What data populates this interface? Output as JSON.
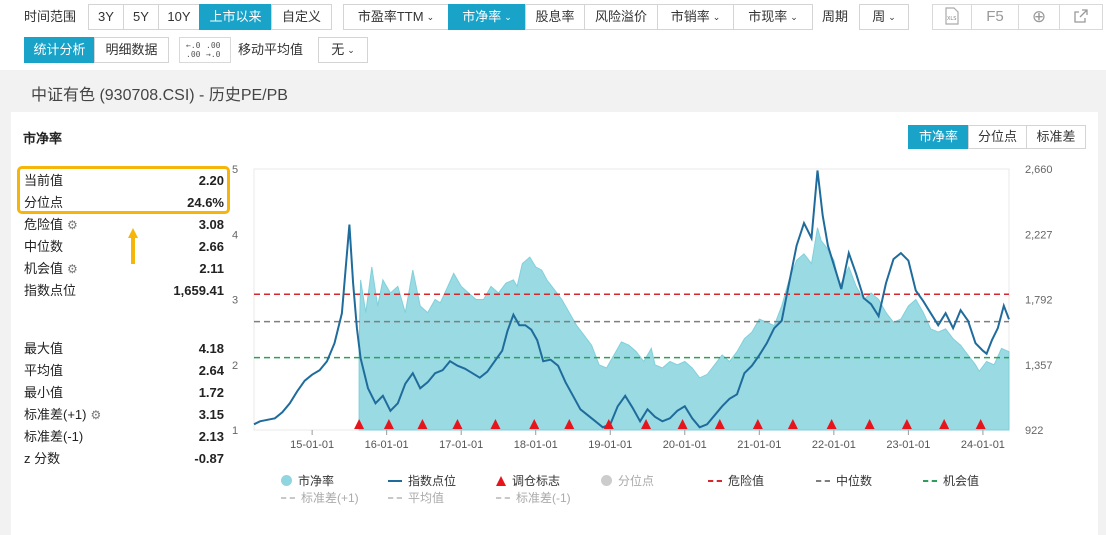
{
  "toolbar": {
    "time_range_label": "时间范围",
    "ranges": [
      "3Y",
      "5Y",
      "10Y",
      "上市以来",
      "自定义"
    ],
    "metrics": [
      "市盈率TTM",
      "市净率",
      "股息率",
      "风险溢价",
      "市销率",
      "市现率"
    ],
    "period_label": "周期",
    "period_value": "周",
    "xls_label": "XLS",
    "f5_label": "F5",
    "view_tabs": [
      "统计分析",
      "明细数据"
    ],
    "ma_label": "移动平均值",
    "ma_value": "无"
  },
  "page_title": "中证有色 (930708.CSI) - 历史PE/PB",
  "panel": {
    "title": "市净率",
    "stats": [
      {
        "label": "当前值",
        "value": "2.20"
      },
      {
        "label": "分位点",
        "value": "24.6%"
      },
      {
        "label": "危险值",
        "value": "3.08",
        "gear": true
      },
      {
        "label": "中位数",
        "value": "2.66"
      },
      {
        "label": "机会值",
        "value": "2.11",
        "gear": true
      },
      {
        "label": "指数点位",
        "value": "1,659.41"
      },
      {
        "label": "最大值",
        "value": "4.18"
      },
      {
        "label": "平均值",
        "value": "2.64"
      },
      {
        "label": "最小值",
        "value": "1.72"
      },
      {
        "label": "标准差(+1)",
        "value": "3.15",
        "gear": true
      },
      {
        "label": "标准差(-1)",
        "value": "2.13"
      },
      {
        "label": "z 分数",
        "value": "-0.87"
      }
    ],
    "right_tabs": [
      "市净率",
      "分位点",
      "标准差"
    ]
  },
  "legend": {
    "items": [
      "市净率",
      "指数点位",
      "调仓标志",
      "分位点",
      "危险值",
      "中位数",
      "机会值"
    ],
    "items2": [
      "标准差(+1)",
      "平均值",
      "标准差(-1)"
    ]
  },
  "colors": {
    "accent": "#1aa3c9",
    "pb_fill": "#8fd6e0",
    "index_line": "#1f6c9c",
    "danger": "#d6272c",
    "median": "#7f7f7f",
    "opportunity": "#2ca05a",
    "rebalance": "#e8141b"
  },
  "chart_data": {
    "type": "area",
    "y_left_ticks": [
      "1",
      "2",
      "3",
      "4",
      "5"
    ],
    "y_right_ticks": [
      "922",
      "1,357",
      "1,792",
      "2,227",
      "2,660"
    ],
    "ylim_left": [
      1,
      5
    ],
    "ylim_right": [
      922,
      2660
    ],
    "x_ticks": [
      "15-01-01",
      "16-01-01",
      "17-01-01",
      "18-01-01",
      "19-01-01",
      "20-01-01",
      "21-01-01",
      "22-01-01",
      "23-01-01",
      "24-01-01"
    ],
    "x_start": 2014.22,
    "x_end": 2024.35,
    "reference_lines": {
      "danger": 3.08,
      "median": 2.66,
      "opportunity": 2.11
    },
    "rebalance_dates": [
      2015.63,
      2016.03,
      2016.48,
      2016.95,
      2017.46,
      2017.98,
      2018.45,
      2018.98,
      2019.48,
      2019.97,
      2020.47,
      2020.98,
      2021.45,
      2021.97,
      2022.48,
      2022.98,
      2023.48,
      2023.97
    ],
    "series": [
      {
        "name": "市净率",
        "axis": "left",
        "points": [
          [
            2015.63,
            2.3
          ],
          [
            2015.65,
            3.3
          ],
          [
            2015.72,
            2.8
          ],
          [
            2015.8,
            3.5
          ],
          [
            2015.88,
            2.9
          ],
          [
            2015.95,
            3.3
          ],
          [
            2016.05,
            3.1
          ],
          [
            2016.15,
            3.2
          ],
          [
            2016.25,
            2.8
          ],
          [
            2016.35,
            3.45
          ],
          [
            2016.45,
            2.9
          ],
          [
            2016.55,
            2.8
          ],
          [
            2016.65,
            3.0
          ],
          [
            2016.72,
            2.95
          ],
          [
            2016.82,
            3.2
          ],
          [
            2016.9,
            3.4
          ],
          [
            2017.0,
            3.2
          ],
          [
            2017.1,
            3.1
          ],
          [
            2017.2,
            3.0
          ],
          [
            2017.3,
            3.0
          ],
          [
            2017.4,
            3.2
          ],
          [
            2017.5,
            3.1
          ],
          [
            2017.6,
            3.25
          ],
          [
            2017.7,
            3.3
          ],
          [
            2017.75,
            3.2
          ],
          [
            2017.82,
            3.55
          ],
          [
            2017.92,
            3.65
          ],
          [
            2018.0,
            3.5
          ],
          [
            2018.08,
            3.45
          ],
          [
            2018.15,
            3.3
          ],
          [
            2018.25,
            3.15
          ],
          [
            2018.35,
            3.0
          ],
          [
            2018.45,
            2.8
          ],
          [
            2018.55,
            2.6
          ],
          [
            2018.65,
            2.45
          ],
          [
            2018.75,
            2.3
          ],
          [
            2018.85,
            2.0
          ],
          [
            2018.95,
            1.95
          ],
          [
            2019.05,
            2.15
          ],
          [
            2019.15,
            2.35
          ],
          [
            2019.25,
            2.3
          ],
          [
            2019.35,
            2.2
          ],
          [
            2019.45,
            2.05
          ],
          [
            2019.55,
            2.25
          ],
          [
            2019.6,
            2.0
          ],
          [
            2019.7,
            1.95
          ],
          [
            2019.8,
            2.05
          ],
          [
            2019.9,
            2.0
          ],
          [
            2020.0,
            2.05
          ],
          [
            2020.1,
            1.95
          ],
          [
            2020.2,
            1.8
          ],
          [
            2020.3,
            1.85
          ],
          [
            2020.4,
            2.0
          ],
          [
            2020.5,
            2.15
          ],
          [
            2020.6,
            2.05
          ],
          [
            2020.7,
            2.2
          ],
          [
            2020.8,
            2.4
          ],
          [
            2020.9,
            2.5
          ],
          [
            2021.0,
            2.7
          ],
          [
            2021.1,
            2.65
          ],
          [
            2021.2,
            2.6
          ],
          [
            2021.3,
            2.9
          ],
          [
            2021.4,
            3.3
          ],
          [
            2021.5,
            3.6
          ],
          [
            2021.6,
            3.7
          ],
          [
            2021.7,
            3.55
          ],
          [
            2021.78,
            4.1
          ],
          [
            2021.83,
            3.9
          ],
          [
            2021.9,
            3.8
          ],
          [
            2022.0,
            3.6
          ],
          [
            2022.08,
            3.2
          ],
          [
            2022.2,
            3.5
          ],
          [
            2022.3,
            3.2
          ],
          [
            2022.4,
            3.0
          ],
          [
            2022.5,
            3.1
          ],
          [
            2022.6,
            3.0
          ],
          [
            2022.7,
            2.8
          ],
          [
            2022.8,
            2.65
          ],
          [
            2022.9,
            2.7
          ],
          [
            2023.0,
            2.9
          ],
          [
            2023.1,
            3.0
          ],
          [
            2023.2,
            2.8
          ],
          [
            2023.3,
            2.55
          ],
          [
            2023.4,
            2.5
          ],
          [
            2023.5,
            2.55
          ],
          [
            2023.6,
            2.4
          ],
          [
            2023.7,
            2.3
          ],
          [
            2023.8,
            2.15
          ],
          [
            2023.9,
            2.0
          ],
          [
            2023.95,
            1.9
          ],
          [
            2024.05,
            2.05
          ],
          [
            2024.15,
            2.0
          ],
          [
            2024.25,
            2.25
          ],
          [
            2024.35,
            2.2
          ]
        ]
      },
      {
        "name": "指数点位",
        "axis": "right",
        "points": [
          [
            2014.22,
            960
          ],
          [
            2014.3,
            980
          ],
          [
            2014.4,
            990
          ],
          [
            2014.5,
            1000
          ],
          [
            2014.6,
            1040
          ],
          [
            2014.7,
            1100
          ],
          [
            2014.8,
            1180
          ],
          [
            2014.9,
            1250
          ],
          [
            2015.0,
            1290
          ],
          [
            2015.1,
            1320
          ],
          [
            2015.2,
            1380
          ],
          [
            2015.3,
            1500
          ],
          [
            2015.4,
            1700
          ],
          [
            2015.45,
            2000
          ],
          [
            2015.5,
            2290
          ],
          [
            2015.55,
            1900
          ],
          [
            2015.6,
            1600
          ],
          [
            2015.65,
            1400
          ],
          [
            2015.75,
            1200
          ],
          [
            2015.85,
            1100
          ],
          [
            2015.95,
            1150
          ],
          [
            2016.05,
            1050
          ],
          [
            2016.15,
            1100
          ],
          [
            2016.25,
            1230
          ],
          [
            2016.35,
            1300
          ],
          [
            2016.45,
            1200
          ],
          [
            2016.55,
            1240
          ],
          [
            2016.65,
            1300
          ],
          [
            2016.75,
            1320
          ],
          [
            2016.85,
            1380
          ],
          [
            2016.95,
            1350
          ],
          [
            2017.05,
            1330
          ],
          [
            2017.15,
            1300
          ],
          [
            2017.25,
            1270
          ],
          [
            2017.35,
            1310
          ],
          [
            2017.45,
            1380
          ],
          [
            2017.55,
            1450
          ],
          [
            2017.62,
            1580
          ],
          [
            2017.7,
            1690
          ],
          [
            2017.78,
            1620
          ],
          [
            2017.86,
            1620
          ],
          [
            2017.94,
            1590
          ],
          [
            2018.02,
            1520
          ],
          [
            2018.1,
            1380
          ],
          [
            2018.2,
            1390
          ],
          [
            2018.3,
            1350
          ],
          [
            2018.4,
            1240
          ],
          [
            2018.5,
            1150
          ],
          [
            2018.6,
            1060
          ],
          [
            2018.7,
            1020
          ],
          [
            2018.8,
            980
          ],
          [
            2018.9,
            940
          ],
          [
            2019.0,
            960
          ],
          [
            2019.1,
            1080
          ],
          [
            2019.2,
            1150
          ],
          [
            2019.3,
            1070
          ],
          [
            2019.4,
            980
          ],
          [
            2019.5,
            1060
          ],
          [
            2019.6,
            1010
          ],
          [
            2019.7,
            980
          ],
          [
            2019.8,
            1000
          ],
          [
            2019.9,
            1050
          ],
          [
            2020.0,
            1080
          ],
          [
            2020.1,
            1000
          ],
          [
            2020.2,
            940
          ],
          [
            2020.3,
            960
          ],
          [
            2020.4,
            1020
          ],
          [
            2020.5,
            1080
          ],
          [
            2020.6,
            1130
          ],
          [
            2020.7,
            1160
          ],
          [
            2020.8,
            1300
          ],
          [
            2020.9,
            1350
          ],
          [
            2021.0,
            1420
          ],
          [
            2021.1,
            1500
          ],
          [
            2021.2,
            1600
          ],
          [
            2021.3,
            1650
          ],
          [
            2021.4,
            1900
          ],
          [
            2021.5,
            2150
          ],
          [
            2021.6,
            2300
          ],
          [
            2021.7,
            2200
          ],
          [
            2021.78,
            2650
          ],
          [
            2021.85,
            2350
          ],
          [
            2021.92,
            2150
          ],
          [
            2022.0,
            2020
          ],
          [
            2022.1,
            1860
          ],
          [
            2022.2,
            2100
          ],
          [
            2022.3,
            1960
          ],
          [
            2022.4,
            1800
          ],
          [
            2022.5,
            1760
          ],
          [
            2022.6,
            1680
          ],
          [
            2022.7,
            1900
          ],
          [
            2022.8,
            2060
          ],
          [
            2022.9,
            2100
          ],
          [
            2023.0,
            2050
          ],
          [
            2023.1,
            1850
          ],
          [
            2023.2,
            1780
          ],
          [
            2023.3,
            1700
          ],
          [
            2023.4,
            1620
          ],
          [
            2023.5,
            1700
          ],
          [
            2023.6,
            1600
          ],
          [
            2023.7,
            1720
          ],
          [
            2023.8,
            1650
          ],
          [
            2023.9,
            1500
          ],
          [
            2024.0,
            1450
          ],
          [
            2024.05,
            1430
          ],
          [
            2024.12,
            1520
          ],
          [
            2024.2,
            1600
          ],
          [
            2024.28,
            1750
          ],
          [
            2024.35,
            1659
          ]
        ]
      }
    ]
  }
}
